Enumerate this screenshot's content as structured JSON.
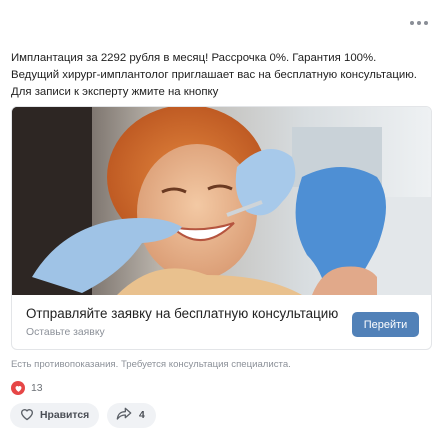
{
  "post": {
    "text": "Имплантация за 2292 рубля в месяц! Рассрочка 0%. Гарантия 100%. Ведущий хирург-имплантолог приглашает вас на бесплатную консультацию. Для записи к эксперту жмите на кнопку",
    "more_icon": "more-horizontal-icon"
  },
  "card": {
    "image_desc": "dentist-patient-photo",
    "title": "Отправляйте заявку на бесплатную консультацию",
    "subtitle": "Оставьте заявку",
    "button_label": "Перейти"
  },
  "disclaimer": "Есть противопоказания. Требуется консультация специалиста.",
  "reactions": {
    "icon": "heart-icon",
    "count": "13"
  },
  "actions": {
    "like_label": "Нравится",
    "like_icon": "heart-outline-icon",
    "share_icon": "share-arrow-icon",
    "share_count": "4"
  },
  "colors": {
    "accent": "#5181b8",
    "heart": "#e64646",
    "muted": "#8c9199"
  }
}
